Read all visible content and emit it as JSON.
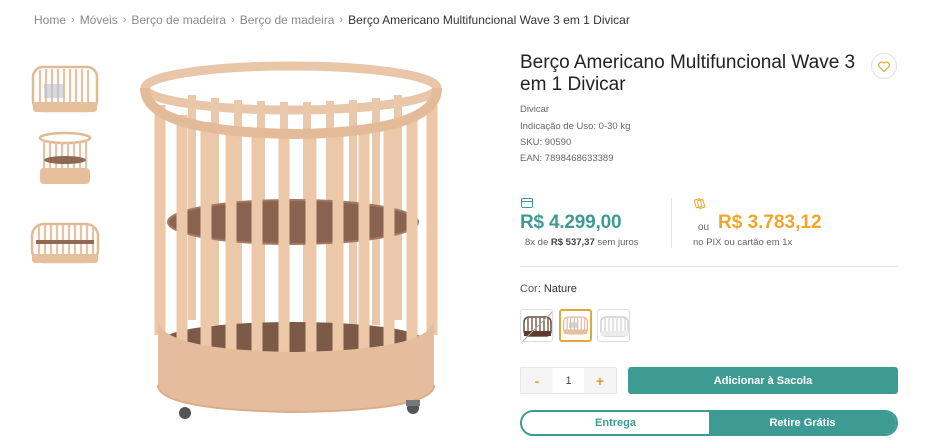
{
  "breadcrumb": {
    "items": [
      "Home",
      "Móveis",
      "Berço de madeira",
      "Berço de madeira"
    ],
    "current": "Berço Americano Multifuncional Wave 3 em 1 Divicar"
  },
  "product": {
    "title": "Berço Americano Multifuncional Wave 3 em 1 Divicar",
    "brand": "Divicar",
    "usage": "Indicação de Uso: 0-30 kg",
    "sku": "SKU: 90590",
    "ean": "EAN: 7898468633389"
  },
  "pricing": {
    "main_price": "R$ 4.299,00",
    "installments_prefix": "8x de",
    "installment_value": "R$ 537,37",
    "installments_suffix": "sem juros",
    "or_label": "ou",
    "pix_price": "R$ 3.783,12",
    "pix_note": "no PIX ou cartão em 1x"
  },
  "color": {
    "label": "Cor:",
    "value": "Nature"
  },
  "quantity": {
    "minus": "-",
    "value": "1",
    "plus": "+"
  },
  "actions": {
    "add_to_bag": "Adicionar à Sacola"
  },
  "delivery": {
    "option_entrega": "Entrega",
    "option_retire": "Retire Grátis"
  },
  "colors": {
    "accent": "#3d9b94",
    "pix": "#f0a52b",
    "wood": "#e8c4a6"
  }
}
